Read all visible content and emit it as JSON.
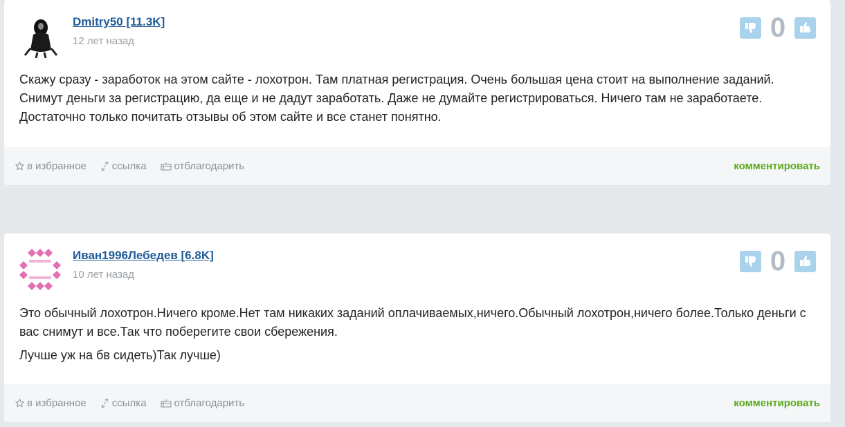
{
  "comments": [
    {
      "author": "Dmitry50 [11.3K]",
      "time": "12 лет назад",
      "votes": "0",
      "paragraphs": [
        "Скажу сразу - заработок на этом сайте - лохотрон. Там платная регистрация. Очень большая цена стоит на выполнение заданий. Снимут деньги за регистрацию, да еще и не дадут заработать. Даже не думайте регистрироваться. Ничего там не заработаете. Достаточно только почитать отзывы об этом сайте и все станет понятно."
      ],
      "footer": {
        "favorite": "в избранное",
        "link": "ссылка",
        "thank": "отблагодарить",
        "comment": "комментировать"
      }
    },
    {
      "author": "Иван1996Лебедев [6.8K]",
      "time": "10 лет назад",
      "votes": "0",
      "paragraphs": [
        "Это обычный лохотрон.Ничего кроме.Нет там никаких заданий оплачиваемых,ничего.Обычный лохотрон,ничего более.Только деньги с вас снимут и все.Так что поберегите свои сбережения.",
        "Лучше уж на бв сидеть)Так лучше)"
      ],
      "footer": {
        "favorite": "в избранное",
        "link": "ссылка",
        "thank": "отблагодарить",
        "comment": "комментировать"
      }
    }
  ],
  "colors": {
    "author_link": "#1f5b98",
    "vote_button": "#a9d2ec",
    "vote_count": "#b1bcc6",
    "comment_link": "#5aab18",
    "page_bg": "#e6e9ec"
  },
  "icons": [
    "thumbs-down-icon",
    "thumbs-up-icon",
    "star-icon",
    "link-icon",
    "thank-icon"
  ]
}
